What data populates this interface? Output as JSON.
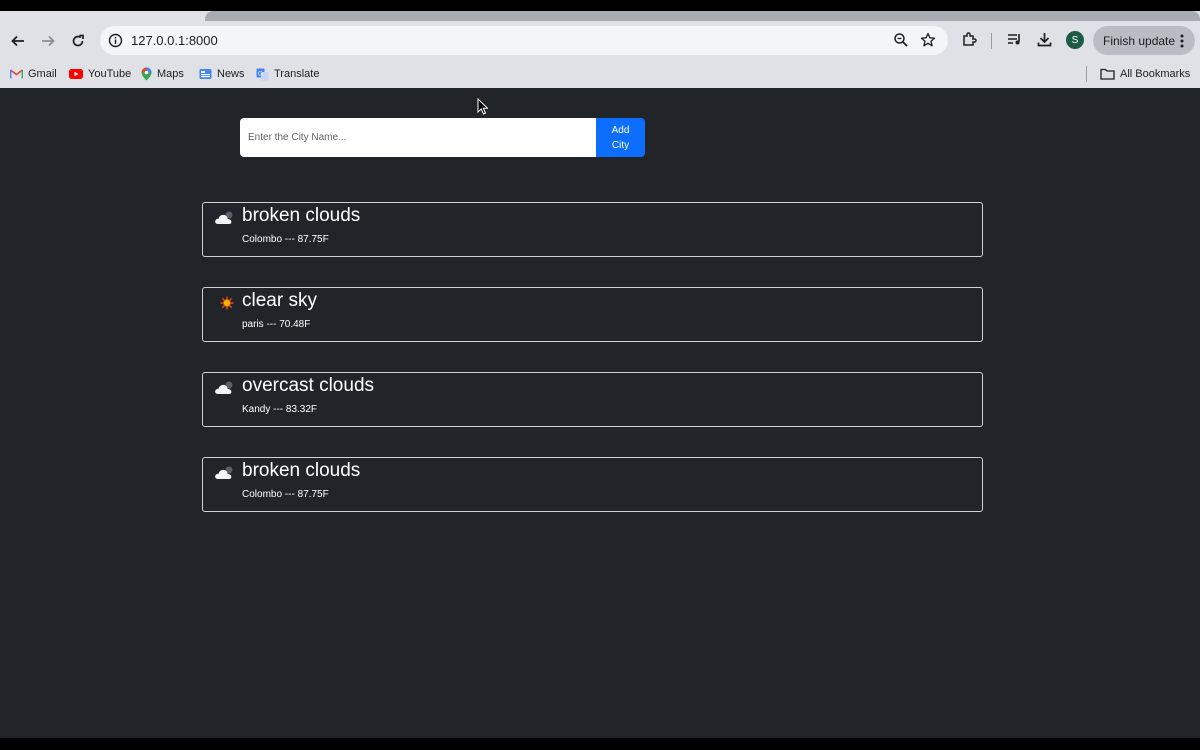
{
  "browser": {
    "url": "127.0.0.1:8000",
    "finish_update_label": "Finish update",
    "avatar_letter": "S",
    "bookmarks": [
      {
        "label": "Gmail",
        "icon": "gmail-icon"
      },
      {
        "label": "YouTube",
        "icon": "youtube-icon"
      },
      {
        "label": "Maps",
        "icon": "maps-icon"
      },
      {
        "label": "News",
        "icon": "news-icon"
      },
      {
        "label": "Translate",
        "icon": "translate-icon"
      }
    ],
    "all_bookmarks_label": "All Bookmarks"
  },
  "page": {
    "search": {
      "placeholder": "Enter the City Name..."
    },
    "add_button": "Add City",
    "accent": "#0d6efd",
    "background": "#212529",
    "cards": [
      {
        "description": "broken clouds",
        "detail": "Colombo --- 87.75F",
        "icon": "cloud-icon"
      },
      {
        "description": "clear sky",
        "detail": "paris --- 70.48F",
        "icon": "sun-icon"
      },
      {
        "description": "overcast clouds",
        "detail": "Kandy --- 83.32F",
        "icon": "cloud-icon"
      },
      {
        "description": "broken clouds",
        "detail": "Colombo --- 87.75F",
        "icon": "cloud-icon"
      }
    ]
  }
}
